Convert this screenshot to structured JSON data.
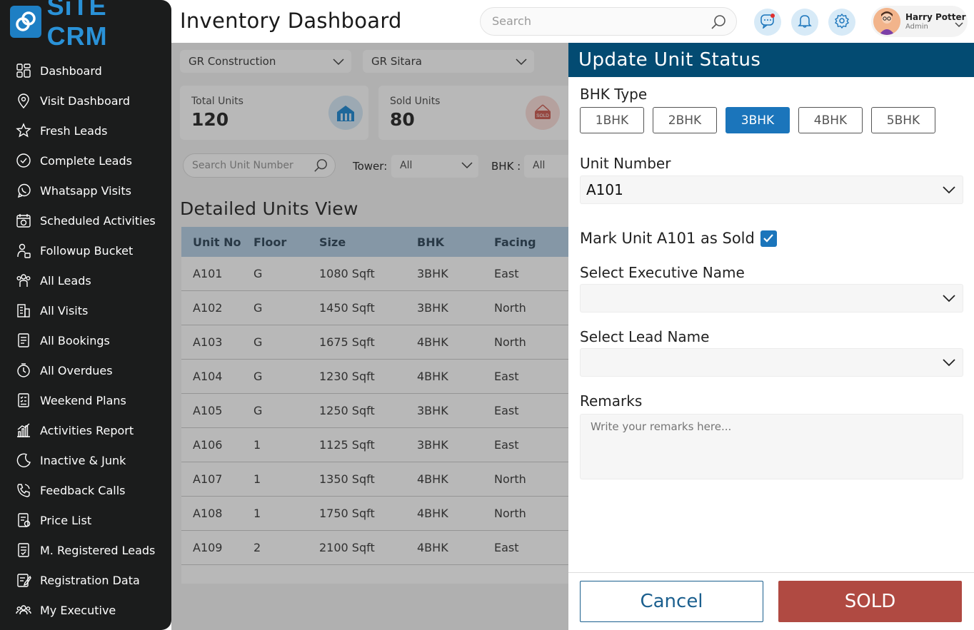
{
  "app": {
    "logo_text": "SiTE CRM",
    "page_title": "Inventory Dashboard"
  },
  "sidebar": {
    "items": [
      {
        "label": "Dashboard",
        "icon": "dashboard-icon"
      },
      {
        "label": "Visit Dashboard",
        "icon": "location-icon"
      },
      {
        "label": "Fresh Leads",
        "icon": "star-icon"
      },
      {
        "label": "Complete Leads",
        "icon": "check-circle-icon"
      },
      {
        "label": "Whatsapp Visits",
        "icon": "whatsapp-icon"
      },
      {
        "label": "Scheduled Activities",
        "icon": "calendar-clock-icon"
      },
      {
        "label": "Followup Bucket",
        "icon": "followup-icon"
      },
      {
        "label": "All Leads",
        "icon": "people-icon"
      },
      {
        "label": "All Visits",
        "icon": "building-icon"
      },
      {
        "label": "All Bookings",
        "icon": "bookings-icon"
      },
      {
        "label": "All Overdues",
        "icon": "overdue-icon"
      },
      {
        "label": "Weekend Plans",
        "icon": "checklist-icon"
      },
      {
        "label": "Activities Report",
        "icon": "bar-chart-icon"
      },
      {
        "label": "Inactive & Junk",
        "icon": "moon-icon"
      },
      {
        "label": "Feedback Calls",
        "icon": "phone-icon"
      },
      {
        "label": "Price List",
        "icon": "price-list-icon"
      },
      {
        "label": "M. Registered Leads",
        "icon": "registered-icon"
      },
      {
        "label": "Registration Data",
        "icon": "registration-icon"
      },
      {
        "label": "My Executive",
        "icon": "team-icon"
      }
    ]
  },
  "header": {
    "search_placeholder": "Search",
    "user_name": "Harry Potter",
    "user_role": "Admin"
  },
  "background": {
    "project_select": "GR Construction",
    "property_select": "GR Sitara",
    "cards": [
      {
        "label": "Total Units",
        "value": "120"
      },
      {
        "label": "Sold Units",
        "value": "80",
        "badge": "SOLD"
      }
    ],
    "unit_search_placeholder": "Search Unit Number",
    "tower_label": "Tower:",
    "tower_value": "All",
    "bhk_label": "BHK :",
    "bhk_value": "All",
    "section_title": "Detailed  Units View",
    "table": {
      "columns": [
        "Unit No",
        "Floor",
        "Size",
        "BHK",
        "Facing"
      ],
      "rows": [
        [
          "A101",
          "G",
          "1080 Sqft",
          "3BHK",
          "East"
        ],
        [
          "A102",
          "G",
          "1450 Sqft",
          "3BHK",
          "North"
        ],
        [
          "A103",
          "G",
          "1675 Sqft",
          "4BHK",
          "North"
        ],
        [
          "A104",
          "G",
          "1230 Sqft",
          "4BHK",
          "East"
        ],
        [
          "A105",
          "G",
          "1250 Sqft",
          "3BHK",
          "East"
        ],
        [
          "A106",
          "1",
          "1125 Sqft",
          "3BHK",
          "East"
        ],
        [
          "A107",
          "1",
          "1350 Sqft",
          "4BHK",
          "North"
        ],
        [
          "A108",
          "1",
          "1750 Sqft",
          "4BHK",
          "North"
        ],
        [
          "A109",
          "2",
          "2100 Sqft",
          "4BHK",
          "East"
        ]
      ]
    }
  },
  "modal": {
    "title": "Update Unit  Status",
    "bhk_label": "BHK Type",
    "bhk_options": [
      "1BHK",
      "2BHK",
      "3BHK",
      "4BHK",
      "5BHK"
    ],
    "bhk_selected": "3BHK",
    "unit_label": "Unit Number",
    "unit_value": "A101",
    "mark_sold_text": "Mark Unit A101 as Sold",
    "mark_sold_checked": true,
    "executive_label": "Select Executive Name",
    "executive_value": "",
    "lead_label": "Select Lead Name",
    "lead_value": "",
    "remarks_label": "Remarks",
    "remarks_placeholder": "Write your remarks here...",
    "cancel_label": "Cancel",
    "sold_label": "SOLD"
  },
  "colors": {
    "sidebar_bg": "#1b1c1c",
    "brand_blue": "#1e7fc4",
    "modal_header": "#034b72",
    "active_chip": "#1b75bb",
    "sold_button": "#b04a42"
  }
}
